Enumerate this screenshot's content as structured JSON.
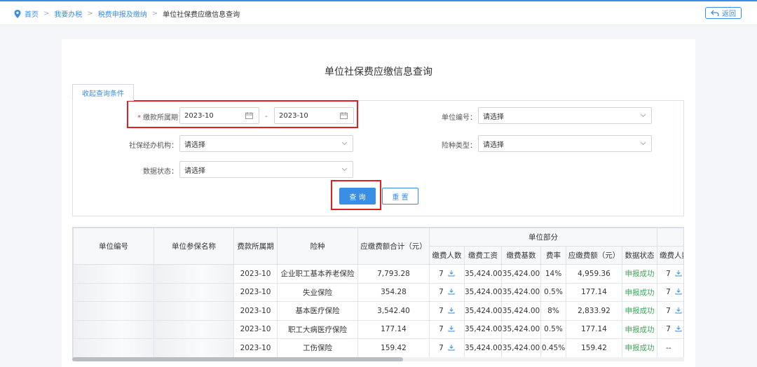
{
  "breadcrumb": {
    "items": [
      "首页",
      "我要办税",
      "税费申报及缴纳"
    ],
    "current": "单位社保费应缴信息查询",
    "separator": ">"
  },
  "back_label": "返回",
  "page_title": "单位社保费应缴信息查询",
  "query_tab_label": "收起查询条件",
  "form": {
    "period": {
      "label": "缴款所属期：",
      "required_mark": "*",
      "start": "2023-10",
      "end": "2023-10",
      "separator": "-"
    },
    "unit_no": {
      "label": "单位编号：",
      "value": "请选择"
    },
    "agency": {
      "label": "社保经办机构：",
      "value": "请选择"
    },
    "insurance_type": {
      "label": "险种类型：",
      "value": "请选择"
    },
    "data_status": {
      "label": "数据状态：",
      "value": "请选择"
    }
  },
  "buttons": {
    "query": "查 询",
    "reset": "重 置"
  },
  "table": {
    "headers": {
      "unit_no": "单位编号",
      "unit_name": "单位参保名称",
      "period": "费款所属期",
      "insurance": "险种",
      "total": "应缴费额合计（元）",
      "group_unit": "单位部分",
      "people": "缴费人数",
      "wage": "缴费工资",
      "base": "缴费基数",
      "rate": "费率",
      "amount": "应缴费额（元）",
      "status": "数据状态",
      "people2": "缴费人数"
    },
    "rows": [
      {
        "period": "2023-10",
        "insurance": "企业职工基本养老保险",
        "total": "7,793.28",
        "people": "7",
        "wage": "35,424.00",
        "base": "35,424.00",
        "rate": "14%",
        "amount": "4,959.36",
        "status": "申报成功",
        "people2": "7"
      },
      {
        "period": "2023-10",
        "insurance": "失业保险",
        "total": "354.28",
        "people": "7",
        "wage": "35,424.00",
        "base": "35,424.00",
        "rate": "0.5%",
        "amount": "177.14",
        "status": "申报成功",
        "people2": "7"
      },
      {
        "period": "2023-10",
        "insurance": "基本医疗保险",
        "total": "3,542.40",
        "people": "7",
        "wage": "35,424.00",
        "base": "35,424.00",
        "rate": "8%",
        "amount": "2,833.92",
        "status": "申报成功",
        "people2": "7"
      },
      {
        "period": "2023-10",
        "insurance": "职工大病医疗保险",
        "total": "177.14",
        "people": "7",
        "wage": "35,424.00",
        "base": "35,424.00",
        "rate": "0.5%",
        "amount": "177.14",
        "status": "申报成功",
        "people2": "7"
      },
      {
        "period": "2023-10",
        "insurance": "工伤保险",
        "total": "159.42",
        "people": "7",
        "wage": "35,424.00",
        "base": "35,424.00",
        "rate": "0.45%",
        "amount": "159.42",
        "status": "申报成功",
        "people2": "--"
      }
    ]
  },
  "colors": {
    "accent": "#3a8ee6",
    "success": "#3aa65a",
    "highlight": "#e02020",
    "required": "#e4393c"
  },
  "icons": [
    "location-pin-icon",
    "back-arrow-icon",
    "calendar-icon",
    "chevron-down-icon",
    "download-icon"
  ]
}
